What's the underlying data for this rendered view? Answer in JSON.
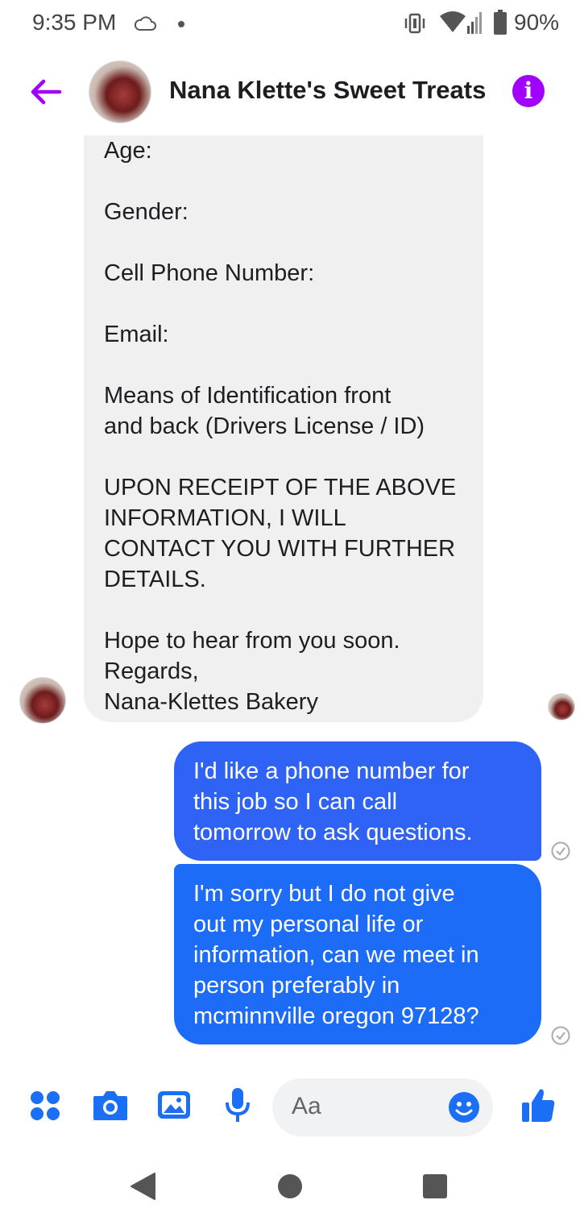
{
  "status_bar": {
    "time": "9:35 PM",
    "battery_percent": "90%",
    "icons": [
      "cloud-icon",
      "notification-dot-icon",
      "vibrate-icon",
      "wifi-icon",
      "signal-icon",
      "battery-icon"
    ]
  },
  "header": {
    "title": "Nana Klette's Sweet Treats",
    "info_glyph": "i",
    "back_icon": "back-arrow-icon",
    "accent_color": "#a100ff"
  },
  "incoming_message": {
    "lines": [
      "Age:",
      "",
      "Gender:",
      "",
      "Cell Phone Number:",
      "",
      "Email:",
      "",
      "Means of Identification front",
      "and back (Drivers License / ID)",
      "",
      "UPON RECEIPT OF THE ABOVE",
      "INFORMATION, I WILL",
      "CONTACT YOU WITH FURTHER",
      "DETAILS.",
      "",
      "Hope to hear from you soon.",
      "Regards,",
      "Nana-Klettes Bakery"
    ]
  },
  "outgoing_messages": [
    {
      "lines": [
        "I'd like a phone number for",
        "this job so I can call",
        "tomorrow to ask questions."
      ],
      "color": "#2f63f5"
    },
    {
      "lines": [
        "I'm sorry but I do not give",
        "out my personal life or",
        "information, can we meet in",
        "person preferably in",
        "mcminnville oregon 97128?"
      ],
      "color": "#1c6cf7"
    }
  ],
  "composer": {
    "placeholder": "Aa",
    "accent_color": "#1a6ff5",
    "icons": [
      "menu-dots-icon",
      "camera-icon",
      "gallery-icon",
      "microphone-icon",
      "emoji-icon",
      "thumbs-up-icon"
    ]
  },
  "nav_bar": {
    "icons": [
      "nav-back-icon",
      "nav-home-icon",
      "nav-recents-icon"
    ]
  }
}
